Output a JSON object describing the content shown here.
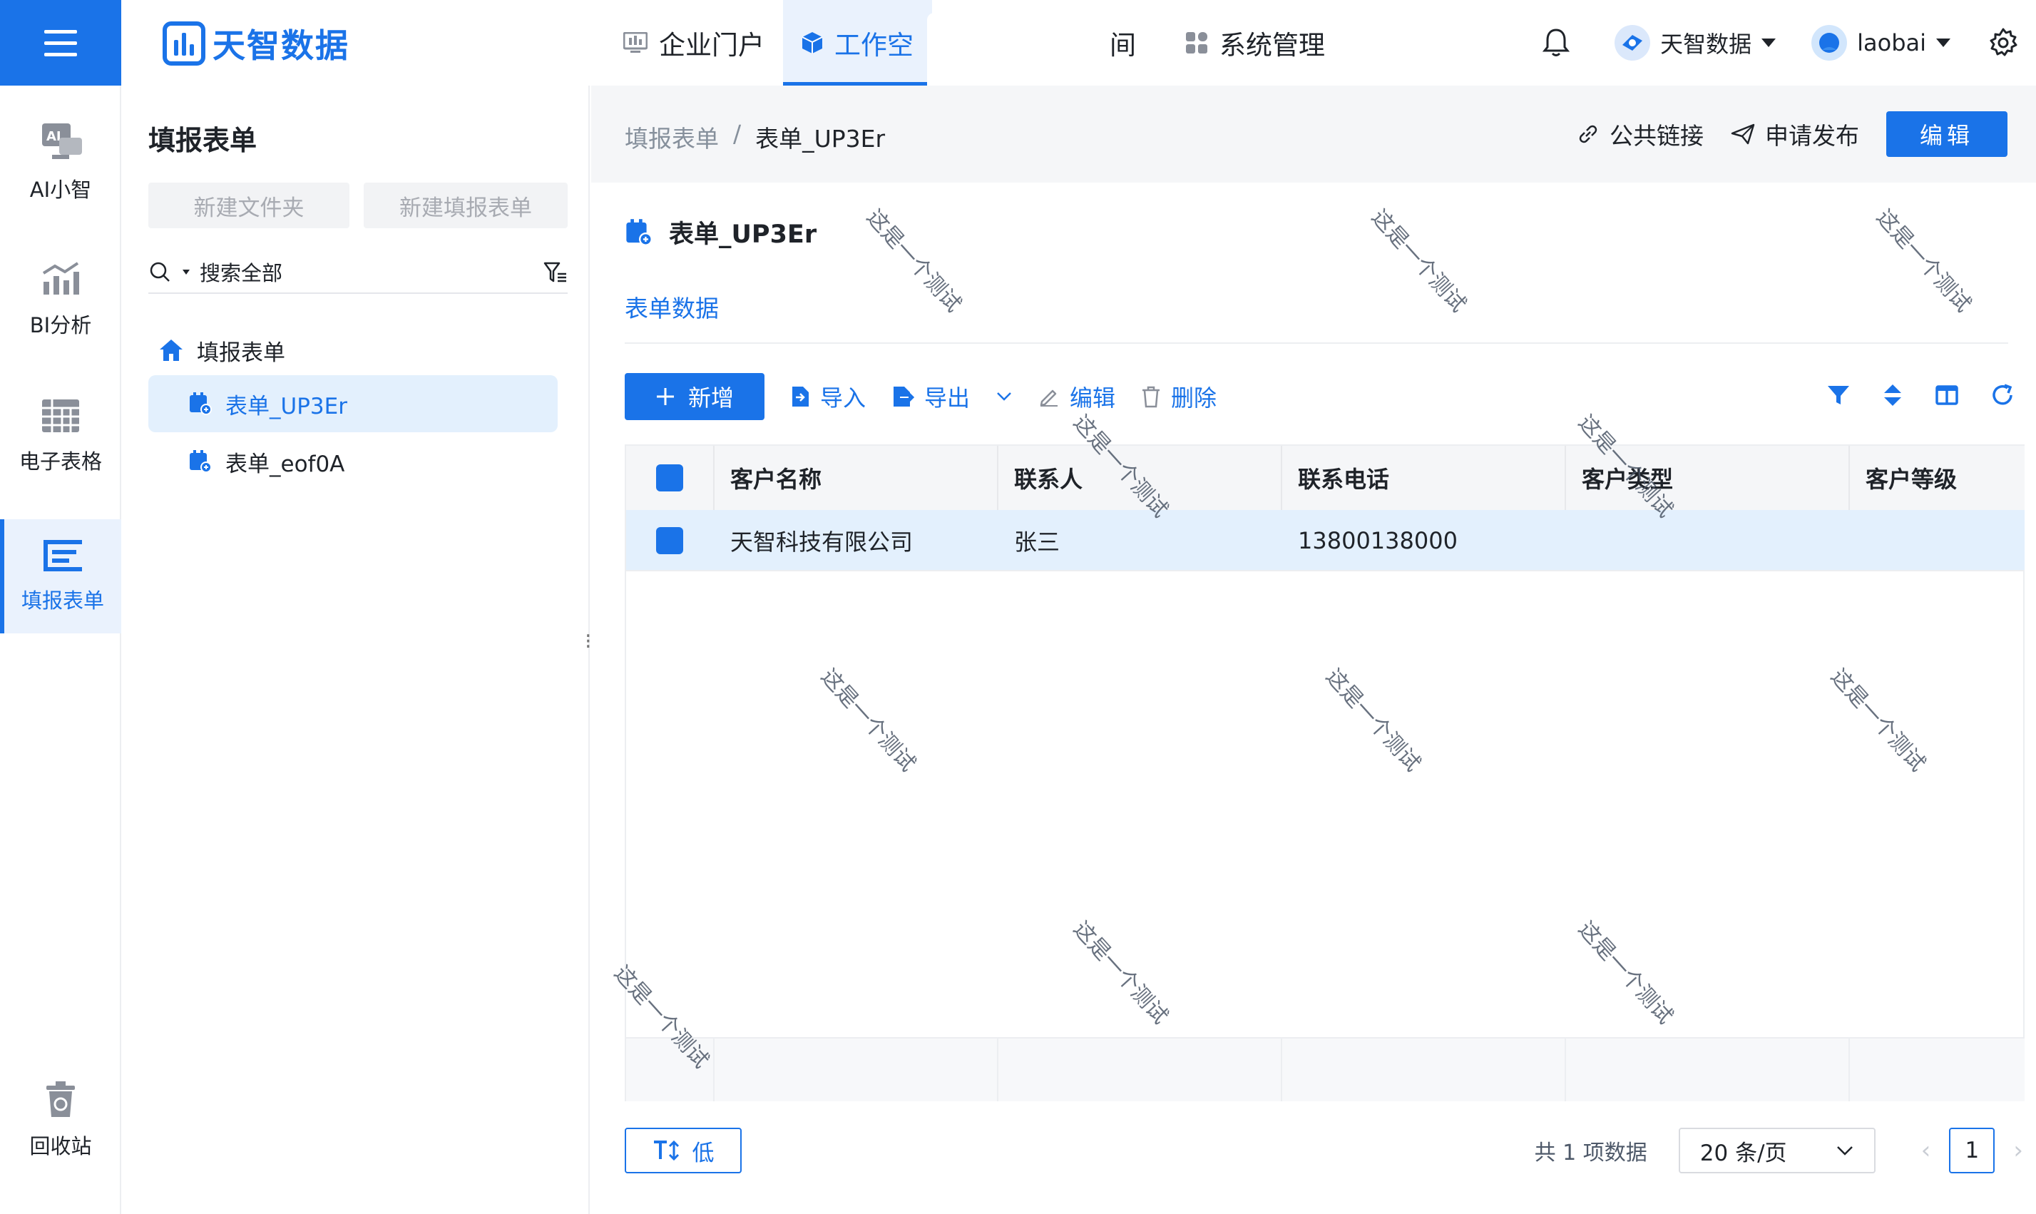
{
  "header": {
    "brand": "天智数据",
    "nav": [
      {
        "label": "企业门户",
        "icon": "portal-icon"
      },
      {
        "label": "工作空",
        "icon": "cube-icon",
        "active": true
      }
    ],
    "nav_tail": "间",
    "nav_admin": {
      "label": "系统管理",
      "icon": "grid-icon"
    },
    "tenant": "天智数据",
    "user": "laobai"
  },
  "rail": [
    {
      "label": "AI小智",
      "icon": "ai-assistant-icon"
    },
    {
      "label": "BI分析",
      "icon": "bi-chart-icon"
    },
    {
      "label": "电子表格",
      "icon": "spreadsheet-icon"
    },
    {
      "label": "填报表单",
      "icon": "form-icon",
      "active": true
    },
    {
      "label": "回收站",
      "icon": "recycle-bin-icon"
    }
  ],
  "tree": {
    "title": "填报表单",
    "new_folder": "新建文件夹",
    "new_form": "新建填报表单",
    "search_label": "搜索全部",
    "root": "填报表单",
    "items": [
      "表单_UP3Er",
      "表单_eof0A"
    ]
  },
  "breadcrumb": {
    "parent": "填报表单",
    "sep": "/",
    "current": "表单_UP3Er"
  },
  "actions": {
    "public_link": "公共链接",
    "publish": "申请发布",
    "edit": "编辑"
  },
  "form": {
    "title": "表单_UP3Er",
    "tab": "表单数据"
  },
  "toolbar": {
    "add": "新增",
    "import": "导入",
    "export": "导出",
    "edit": "编辑",
    "delete": "删除"
  },
  "table": {
    "columns": [
      "客户名称",
      "联系人",
      "联系电话",
      "客户类型",
      "客户等级"
    ],
    "rows": [
      {
        "name": "天智科技有限公司",
        "contact": "张三",
        "phone": "13800138000",
        "type": "",
        "level": ""
      }
    ]
  },
  "footer": {
    "density": "低",
    "total": "共 1 项数据",
    "page_size": "20 条/页",
    "page": "1"
  },
  "watermark": "这是一个测试",
  "colors": {
    "primary": "#1a73e8",
    "selected_bg": "#e3f0fd"
  }
}
